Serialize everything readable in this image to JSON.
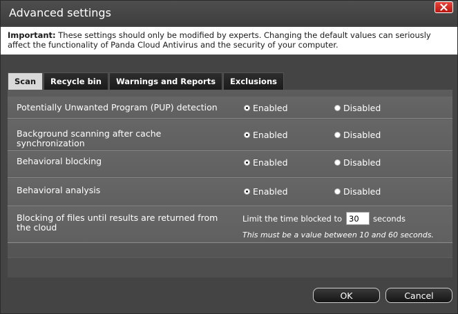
{
  "dialog": {
    "title": "Advanced settings",
    "close_icon": "close-icon"
  },
  "warning": {
    "strong": "Important:",
    "line1": " These settings should only be modified by experts. Changing the default values can seriously",
    "line2": "affect the functionality of Panda Cloud Antivirus and the security of your computer."
  },
  "tabs": [
    {
      "label": "Scan",
      "active": true
    },
    {
      "label": "Recycle bin",
      "active": false
    },
    {
      "label": "Warnings and Reports",
      "active": false
    },
    {
      "label": "Exclusions",
      "active": false
    }
  ],
  "settings": [
    {
      "label": "Potentially Unwanted Program (PUP) detection",
      "enabled_label": "Enabled",
      "disabled_label": "Disabled",
      "selected": "Enabled"
    },
    {
      "label": "Background scanning after cache synchronization",
      "enabled_label": "Enabled",
      "disabled_label": "Disabled",
      "selected": "Enabled"
    },
    {
      "label": "Behavioral blocking",
      "enabled_label": "Enabled",
      "disabled_label": "Disabled",
      "selected": "Enabled"
    },
    {
      "label": "Behavioral analysis",
      "enabled_label": "Enabled",
      "disabled_label": "Disabled",
      "selected": "Enabled"
    }
  ],
  "blocking": {
    "label": "Blocking of files until results are returned from the cloud",
    "limit_label": "Limit the time blocked to",
    "value": "30",
    "seconds_label": "seconds",
    "hint": "This must be a value between 10 and 60 seconds."
  },
  "buttons": {
    "ok": "OK",
    "cancel": "Cancel"
  }
}
